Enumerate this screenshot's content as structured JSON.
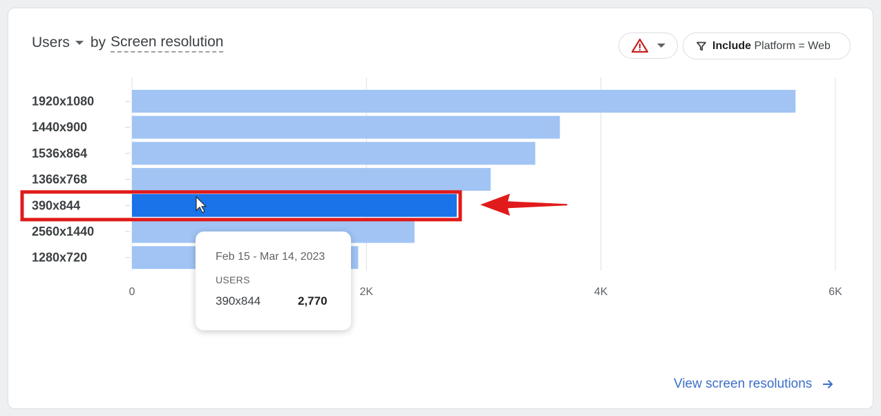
{
  "header": {
    "metric": "Users",
    "dimension_prefix": "by",
    "dimension": "Screen resolution"
  },
  "controls": {
    "warning_icon": "warning-triangle-icon",
    "filter_icon": "filter-icon",
    "filter_keyword": "Include",
    "filter_expression": "Platform = Web"
  },
  "chart_data": {
    "type": "bar",
    "orientation": "horizontal",
    "categories": [
      "1920x1080",
      "1440x900",
      "1536x864",
      "1366x768",
      "390x844",
      "2560x1440",
      "1280x720"
    ],
    "values": [
      5660,
      3650,
      3440,
      3060,
      2770,
      2410,
      1930
    ],
    "xlim": [
      0,
      6000
    ],
    "x_ticks": [
      0,
      2000,
      4000,
      6000
    ],
    "x_tick_labels": [
      "0",
      "2K",
      "4K",
      "6K"
    ],
    "grid": "vertical",
    "highlighted_category": "390x844",
    "colors": {
      "bar": "#a1c4f4",
      "highlight": "#1a73e8",
      "annotation": "#e11b1b"
    }
  },
  "tooltip": {
    "date_range": "Feb 15 - Mar 14, 2023",
    "metric": "USERS",
    "category": "390x844",
    "value": "2,770"
  },
  "footer": {
    "link_label": "View screen resolutions",
    "link_icon": "arrow-right-icon"
  }
}
